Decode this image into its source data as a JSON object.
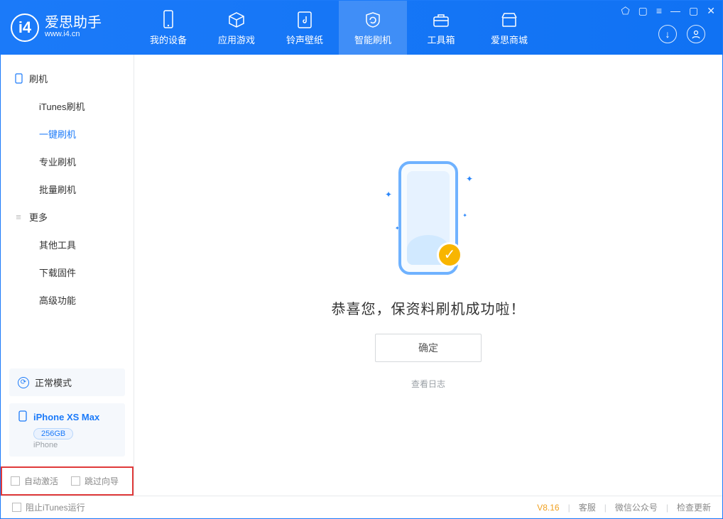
{
  "app": {
    "name_cn": "爱思助手",
    "name_en": "www.i4.cn"
  },
  "nav": {
    "items": [
      {
        "label": "我的设备"
      },
      {
        "label": "应用游戏"
      },
      {
        "label": "铃声壁纸"
      },
      {
        "label": "智能刷机"
      },
      {
        "label": "工具箱"
      },
      {
        "label": "爱思商城"
      }
    ]
  },
  "sidebar": {
    "sec1_title": "刷机",
    "sec1": [
      {
        "label": "iTunes刷机"
      },
      {
        "label": "一键刷机"
      },
      {
        "label": "专业刷机"
      },
      {
        "label": "批量刷机"
      }
    ],
    "sec2_title": "更多",
    "sec2": [
      {
        "label": "其他工具"
      },
      {
        "label": "下载固件"
      },
      {
        "label": "高级功能"
      }
    ],
    "mode": "正常模式",
    "device": {
      "name": "iPhone XS Max",
      "capacity": "256GB",
      "type": "iPhone"
    },
    "chk1": "自动激活",
    "chk2": "跳过向导"
  },
  "main": {
    "message": "恭喜您，保资料刷机成功啦！",
    "ok_label": "确定",
    "log_link": "查看日志"
  },
  "status": {
    "block_itunes": "阻止iTunes运行",
    "version": "V8.16",
    "links": [
      "客服",
      "微信公众号",
      "检查更新"
    ]
  }
}
